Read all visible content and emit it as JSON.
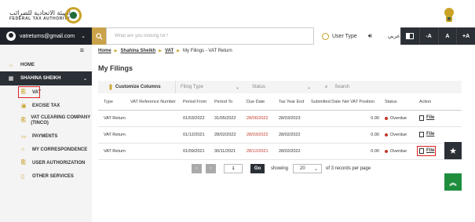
{
  "header": {
    "logo_arabic": "الهيئة الاتحادية للضرائب",
    "logo_english": "FEDERAL TAX AUTHORITY"
  },
  "topbar": {
    "user_email": "vatreturns@gmail.com",
    "search_placeholder": "What are you looking for?",
    "user_type_label": "User Type",
    "arabic_label": "عربي",
    "font_minus": "-A",
    "font_normal": "A",
    "font_plus": "+A"
  },
  "sidebar": {
    "home": "HOME",
    "entity": "SHAHINA SHEIKH",
    "items": [
      {
        "label": "VAT"
      },
      {
        "label": "EXCISE TAX"
      },
      {
        "label": "VAT CLEARING COMPANY (TINCO)"
      },
      {
        "label": "PAYMENTS"
      },
      {
        "label": "MY CORRESPONDENCE"
      },
      {
        "label": "USER AUTHORIZATION"
      },
      {
        "label": "OTHER SERVICES"
      }
    ]
  },
  "breadcrumb": [
    "Home",
    "Shahina Sheikh",
    "VAT",
    "My Filings - VAT Return"
  ],
  "page_title": "My Filings",
  "filters": {
    "customize": "Customize Columns",
    "filing_type": "Filing Type",
    "status": "Status",
    "search": "Search"
  },
  "table": {
    "headers": [
      "Type",
      "VAT Reference Number",
      "Period From",
      "Period To",
      "Due Date",
      "Tax Year End",
      "Submitted Date",
      "Net VAT Position",
      "Status",
      "Action"
    ],
    "rows": [
      {
        "type": "VAT Return",
        "ref": "",
        "from": "01/03/2022",
        "to": "31/05/2022",
        "due": "28/06/2022",
        "tye": "28/03/2023",
        "submitted": "",
        "net": "0.00",
        "status": "Overdue",
        "action": "File"
      },
      {
        "type": "VAT Return",
        "ref": "",
        "from": "01/12/2021",
        "to": "28/02/2022",
        "due": "28/03/2022",
        "tye": "28/02/2022",
        "submitted": "",
        "net": "0.00",
        "status": "Overdue",
        "action": "File"
      },
      {
        "type": "VAT Return",
        "ref": "",
        "from": "01/09/2021",
        "to": "30/11/2021",
        "due": "28/12/2021",
        "tye": "28/02/2022",
        "submitted": "",
        "net": "0.00",
        "status": "Overdue",
        "action": "File"
      }
    ]
  },
  "pagination": {
    "page": "1",
    "go": "Go",
    "showing": "showing",
    "per_page": "20",
    "records_text": "of 3 records per page"
  },
  "colors": {
    "accent_gold": "#c9a227",
    "dark": "#2b2f36",
    "overdue_red": "#c0392b",
    "scroll_up_green": "#1e8e3e"
  }
}
